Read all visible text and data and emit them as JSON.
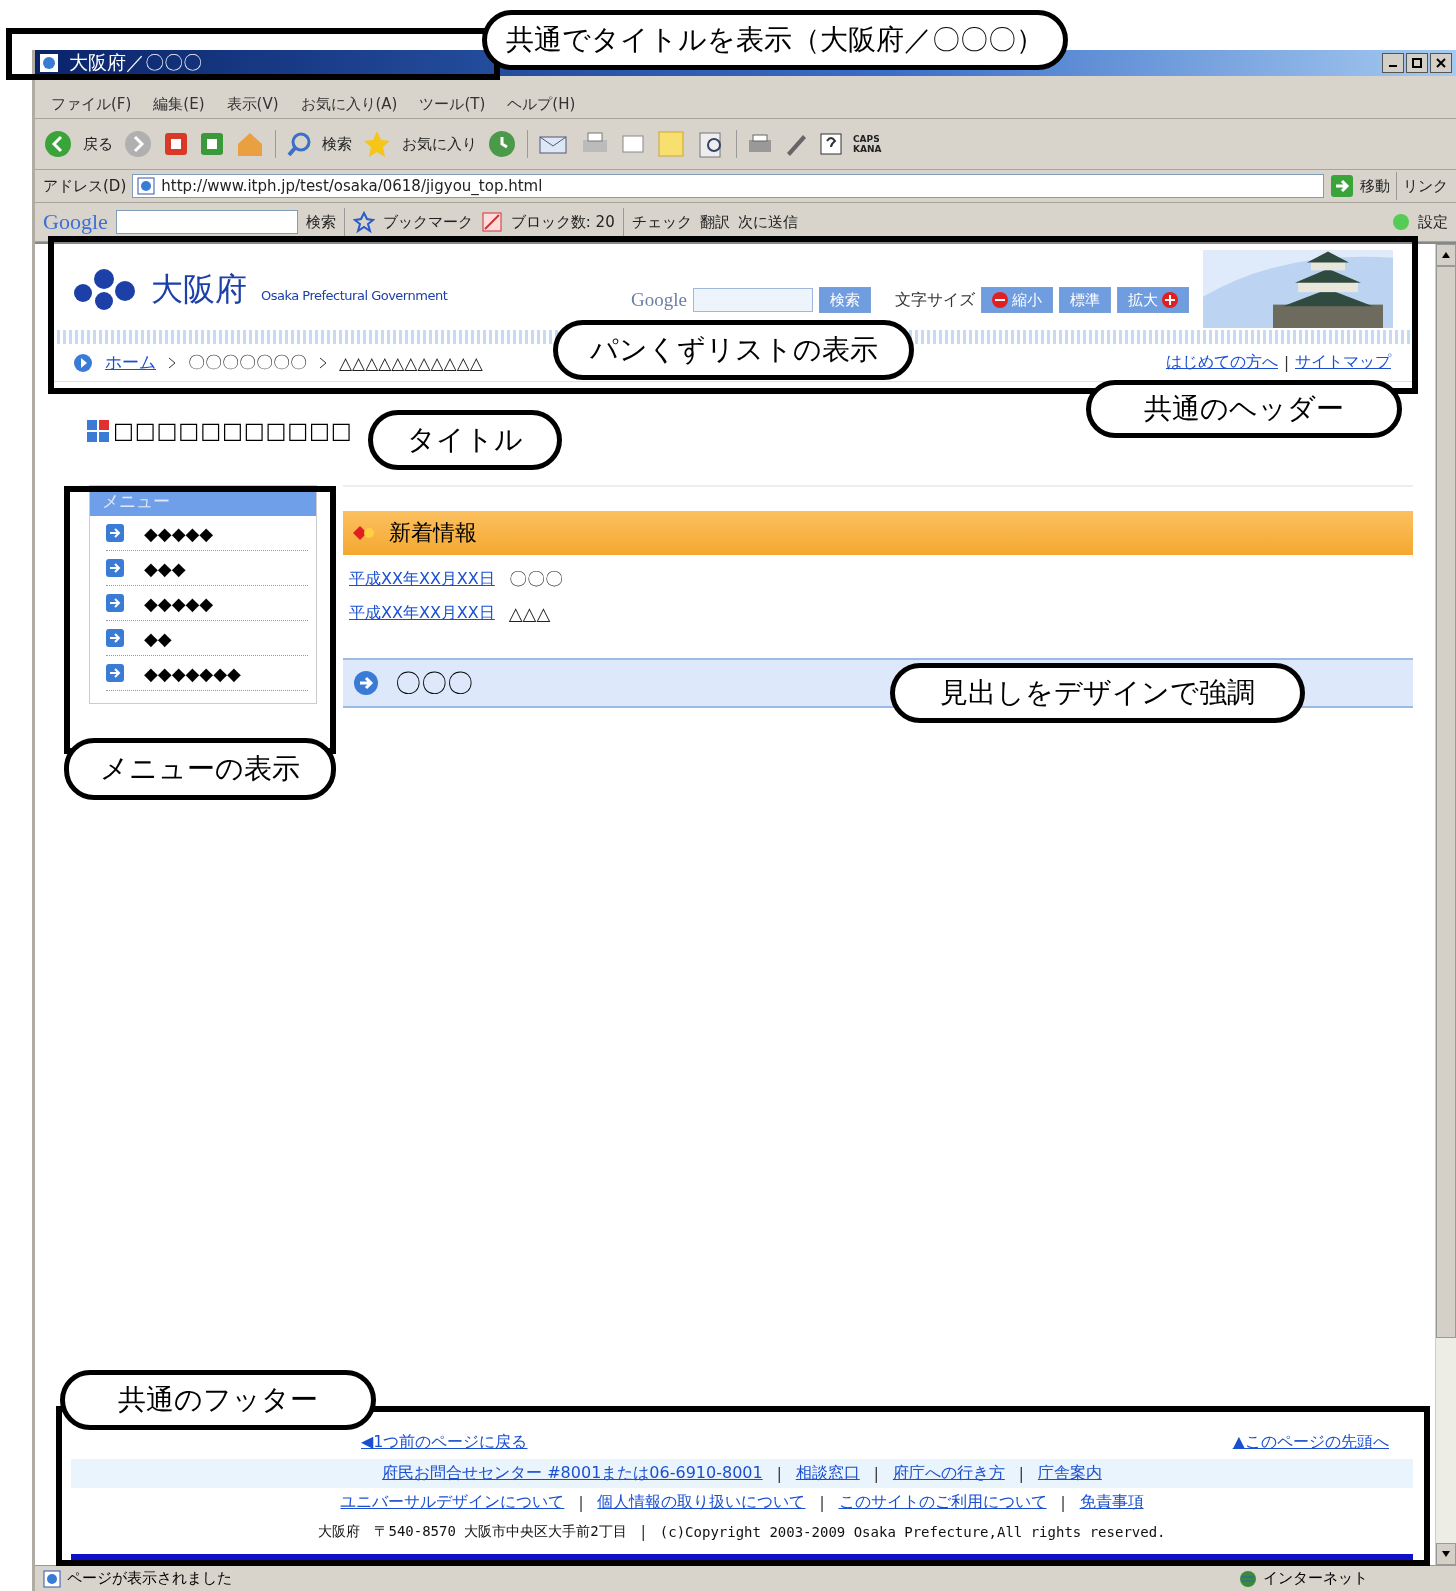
{
  "window": {
    "title": "大阪府／〇〇〇",
    "callout": "共通でタイトルを表示（大阪府／〇〇〇）"
  },
  "menu_bar": [
    "ファイル(F)",
    "編集(E)",
    "表示(V)",
    "お気に入り(A)",
    "ツール(T)",
    "ヘルプ(H)"
  ],
  "toolbar": {
    "back": "戻る",
    "search": "検索",
    "favorites": "お気に入り",
    "caps": "CAPS",
    "kana": "KANA"
  },
  "address_bar": {
    "label": "アドレス(D)",
    "url": "http://www.itph.jp/test/osaka/0618/jigyou_top.html",
    "go": "移動",
    "links": "リンク"
  },
  "google_bar": {
    "logo": "Google",
    "search": "検索",
    "bookmark": "ブックマーク",
    "blocked": "ブロック数: 20",
    "check": "チェック",
    "translate": "翻訳",
    "send": "次に送信",
    "settings": "設定"
  },
  "header": {
    "logo": "大阪府",
    "logo_en": "Osaka Prefectural Government",
    "search_logo": "Google",
    "search_button": "検索",
    "font_size_label": "文字サイズ",
    "font_buttons": [
      {
        "label": "縮小",
        "kind": "minus"
      },
      {
        "label": "標準",
        "kind": "plain"
      },
      {
        "label": "拡大",
        "kind": "plus"
      }
    ],
    "breadcrumbs": [
      "ホーム",
      "〇〇〇〇〇〇〇",
      "△△△△△△△△△△△"
    ],
    "links": [
      {
        "kind": "link",
        "text": "はじめての方へ"
      },
      {
        "kind": "separator",
        "text": "|"
      },
      {
        "kind": "link",
        "text": "サイトマップ"
      }
    ],
    "breadcrumb_callout": "パンくずリストの表示",
    "callout": "共通のヘッダー"
  },
  "page_title": {
    "text": "□□□□□□□□□□□",
    "callout": "タイトル"
  },
  "sidebar": {
    "title": "メニュー",
    "items": [
      "◆◆◆◆◆",
      "◆◆◆",
      "◆◆◆◆◆",
      "◆◆",
      "◆◆◆◆◆◆◆"
    ],
    "callout": "メニューの表示"
  },
  "news": {
    "title": "新着情報",
    "items": [
      {
        "date": "平成XX年XX月XX日",
        "text": "〇〇〇"
      },
      {
        "date": "平成XX年XX月XX日",
        "text": "△△△"
      }
    ]
  },
  "section": {
    "heading": "〇〇〇",
    "callout": "見出しをデザインで強調"
  },
  "footer": {
    "callout": "共通のフッター",
    "back": "◀1つ前のページに戻る",
    "top": "▲このページの先頭へ",
    "rows": [
      {
        "items": [
          {
            "kind": "link",
            "text": "府民お問合せセンター #8001または06-6910-8001"
          },
          {
            "kind": "separator",
            "text": "|"
          },
          {
            "kind": "link",
            "text": "相談窓口"
          },
          {
            "kind": "separator",
            "text": "|"
          },
          {
            "kind": "link",
            "text": "府庁への行き方"
          },
          {
            "kind": "separator",
            "text": "|"
          },
          {
            "kind": "link",
            "text": "庁舎案内"
          }
        ]
      },
      {
        "items": [
          {
            "kind": "link",
            "text": "ユニバーサルデザインについて"
          },
          {
            "kind": "separator",
            "text": "|"
          },
          {
            "kind": "link",
            "text": "個人情報の取り扱いについて"
          },
          {
            "kind": "separator",
            "text": "|"
          },
          {
            "kind": "link",
            "text": "このサイトのご利用について"
          },
          {
            "kind": "separator",
            "text": "|"
          },
          {
            "kind": "link",
            "text": "免責事項"
          }
        ]
      },
      {
        "items": [
          {
            "kind": "text",
            "text": "大阪府　〒540-8570 大阪市中央区大手前2丁目"
          },
          {
            "kind": "separator",
            "text": "|"
          },
          {
            "kind": "text",
            "text": "(c)Copyright 2003-2009 Osaka Prefecture,All rights reserved."
          }
        ]
      }
    ]
  },
  "status_bar": {
    "text": "ページが表示されました",
    "zone": "インターネット"
  }
}
